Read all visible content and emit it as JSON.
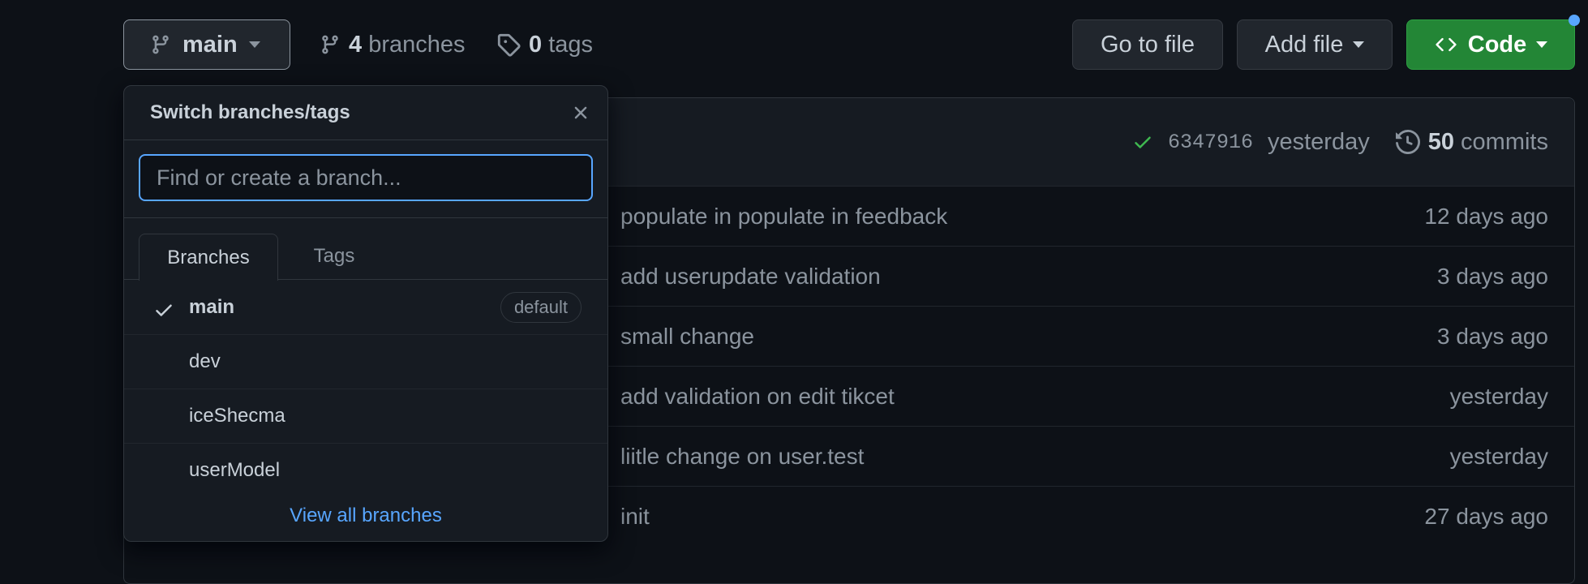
{
  "toolbar": {
    "branch_selector_label": "main",
    "branches_count": "4",
    "branches_label": "branches",
    "tags_count": "0",
    "tags_label": "tags",
    "go_to_file_label": "Go to file",
    "add_file_label": "Add file",
    "code_label": "Code"
  },
  "latest_commit": {
    "sha": "6347916",
    "time": "yesterday",
    "commits_count": "50",
    "commits_label": "commits"
  },
  "files": [
    {
      "message": "populate in populate in feedback",
      "age": "12 days ago"
    },
    {
      "message": "add userupdate validation",
      "age": "3 days ago"
    },
    {
      "message": "small change",
      "age": "3 days ago"
    },
    {
      "message": "add validation on edit tikcet",
      "age": "yesterday"
    },
    {
      "message": "liitle change on user.test",
      "age": "yesterday"
    },
    {
      "message": "init",
      "age": "27 days ago"
    }
  ],
  "dropdown": {
    "title": "Switch branches/tags",
    "search_placeholder": "Find or create a branch...",
    "tabs": [
      "Branches",
      "Tags"
    ],
    "branches": [
      {
        "name": "main",
        "badge": "default",
        "selected": true
      },
      {
        "name": "dev"
      },
      {
        "name": "iceShecma"
      },
      {
        "name": "userModel"
      }
    ],
    "view_all_label": "View all branches"
  },
  "colors": {
    "background": "#0d1117",
    "accent_blue": "#58a6ff",
    "success_green": "#3fb950",
    "code_button_green": "#238636"
  },
  "icons": [
    "git-branch-icon",
    "tag-icon",
    "caret-down-icon",
    "code-icon",
    "check-icon",
    "history-icon",
    "close-icon"
  ]
}
